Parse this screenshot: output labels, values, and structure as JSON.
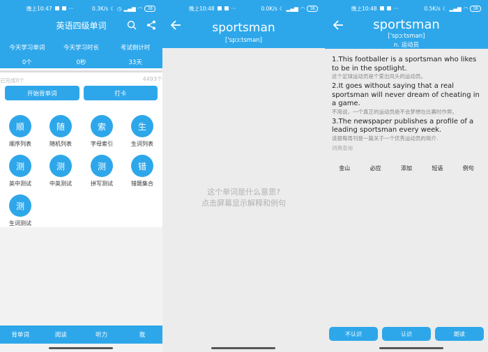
{
  "colors": {
    "accent": "#2ea7ea",
    "hint": "#b2b2b2"
  },
  "panel1": {
    "status": {
      "time": "晚上10:47",
      "speed": "0.3K/s",
      "battery": "38"
    },
    "title": "英语四级单词",
    "stats": [
      {
        "label": "今天学习单词",
        "value": "0个"
      },
      {
        "label": "今天学习时长",
        "value": "0秒"
      },
      {
        "label": "考试倒计时",
        "value": "33天"
      }
    ],
    "progress": {
      "done": "已完成0个",
      "total": "4493个",
      "fraction": 0
    },
    "buttons": {
      "start": "开始背单词",
      "checkin": "打卡"
    },
    "grid": [
      {
        "char": "顺",
        "label": "顺序列表"
      },
      {
        "char": "随",
        "label": "随机列表"
      },
      {
        "char": "索",
        "label": "字母索引"
      },
      {
        "char": "生",
        "label": "生词列表"
      },
      {
        "char": "测",
        "label": "英中测试"
      },
      {
        "char": "测",
        "label": "中英测试"
      },
      {
        "char": "测",
        "label": "拼写测试"
      },
      {
        "char": "错",
        "label": "错题集合"
      },
      {
        "char": "测",
        "label": "生词测试"
      }
    ],
    "tabs": [
      "背单词",
      "阅读",
      "听力",
      "我"
    ]
  },
  "panel2": {
    "status": {
      "time": "晚上10:48",
      "speed": "0.0K/s",
      "battery": "38"
    },
    "word": "sportsman",
    "phonetic": "['spɔːtsman]",
    "hint_line1": "这个单词是什么意思?",
    "hint_line2": "点击屏幕显示解释和例句"
  },
  "panel3": {
    "status": {
      "time": "晚上10:48",
      "speed": "0.5K/s",
      "battery": "38"
    },
    "word": "sportsman",
    "phonetic": "['spɔːtsman]",
    "pos": "n. 运动员",
    "examples": [
      {
        "en": "1.This footballer is a sportsman who likes to be in the spotlight.",
        "cn": "这个足球运动员是个爱出风头的运动员。"
      },
      {
        "en": "2.It goes without saying that a real sportsman will never dream of cheating in a game.",
        "cn": "不用说，一个真正的运动员绝不会梦想在比赛时作弊。"
      },
      {
        "en": "3.The newspaper publishes a profile of a leading sportsman every week.",
        "cn": "该报每周刊登一篇关于一个优秀运动员的简介."
      }
    ],
    "dict": "词典查询",
    "actions": [
      "金山",
      "必应",
      "添加",
      "短语",
      "例句"
    ],
    "bottom": {
      "unknown": "不认识",
      "known": "认识",
      "read": "朗读"
    }
  }
}
